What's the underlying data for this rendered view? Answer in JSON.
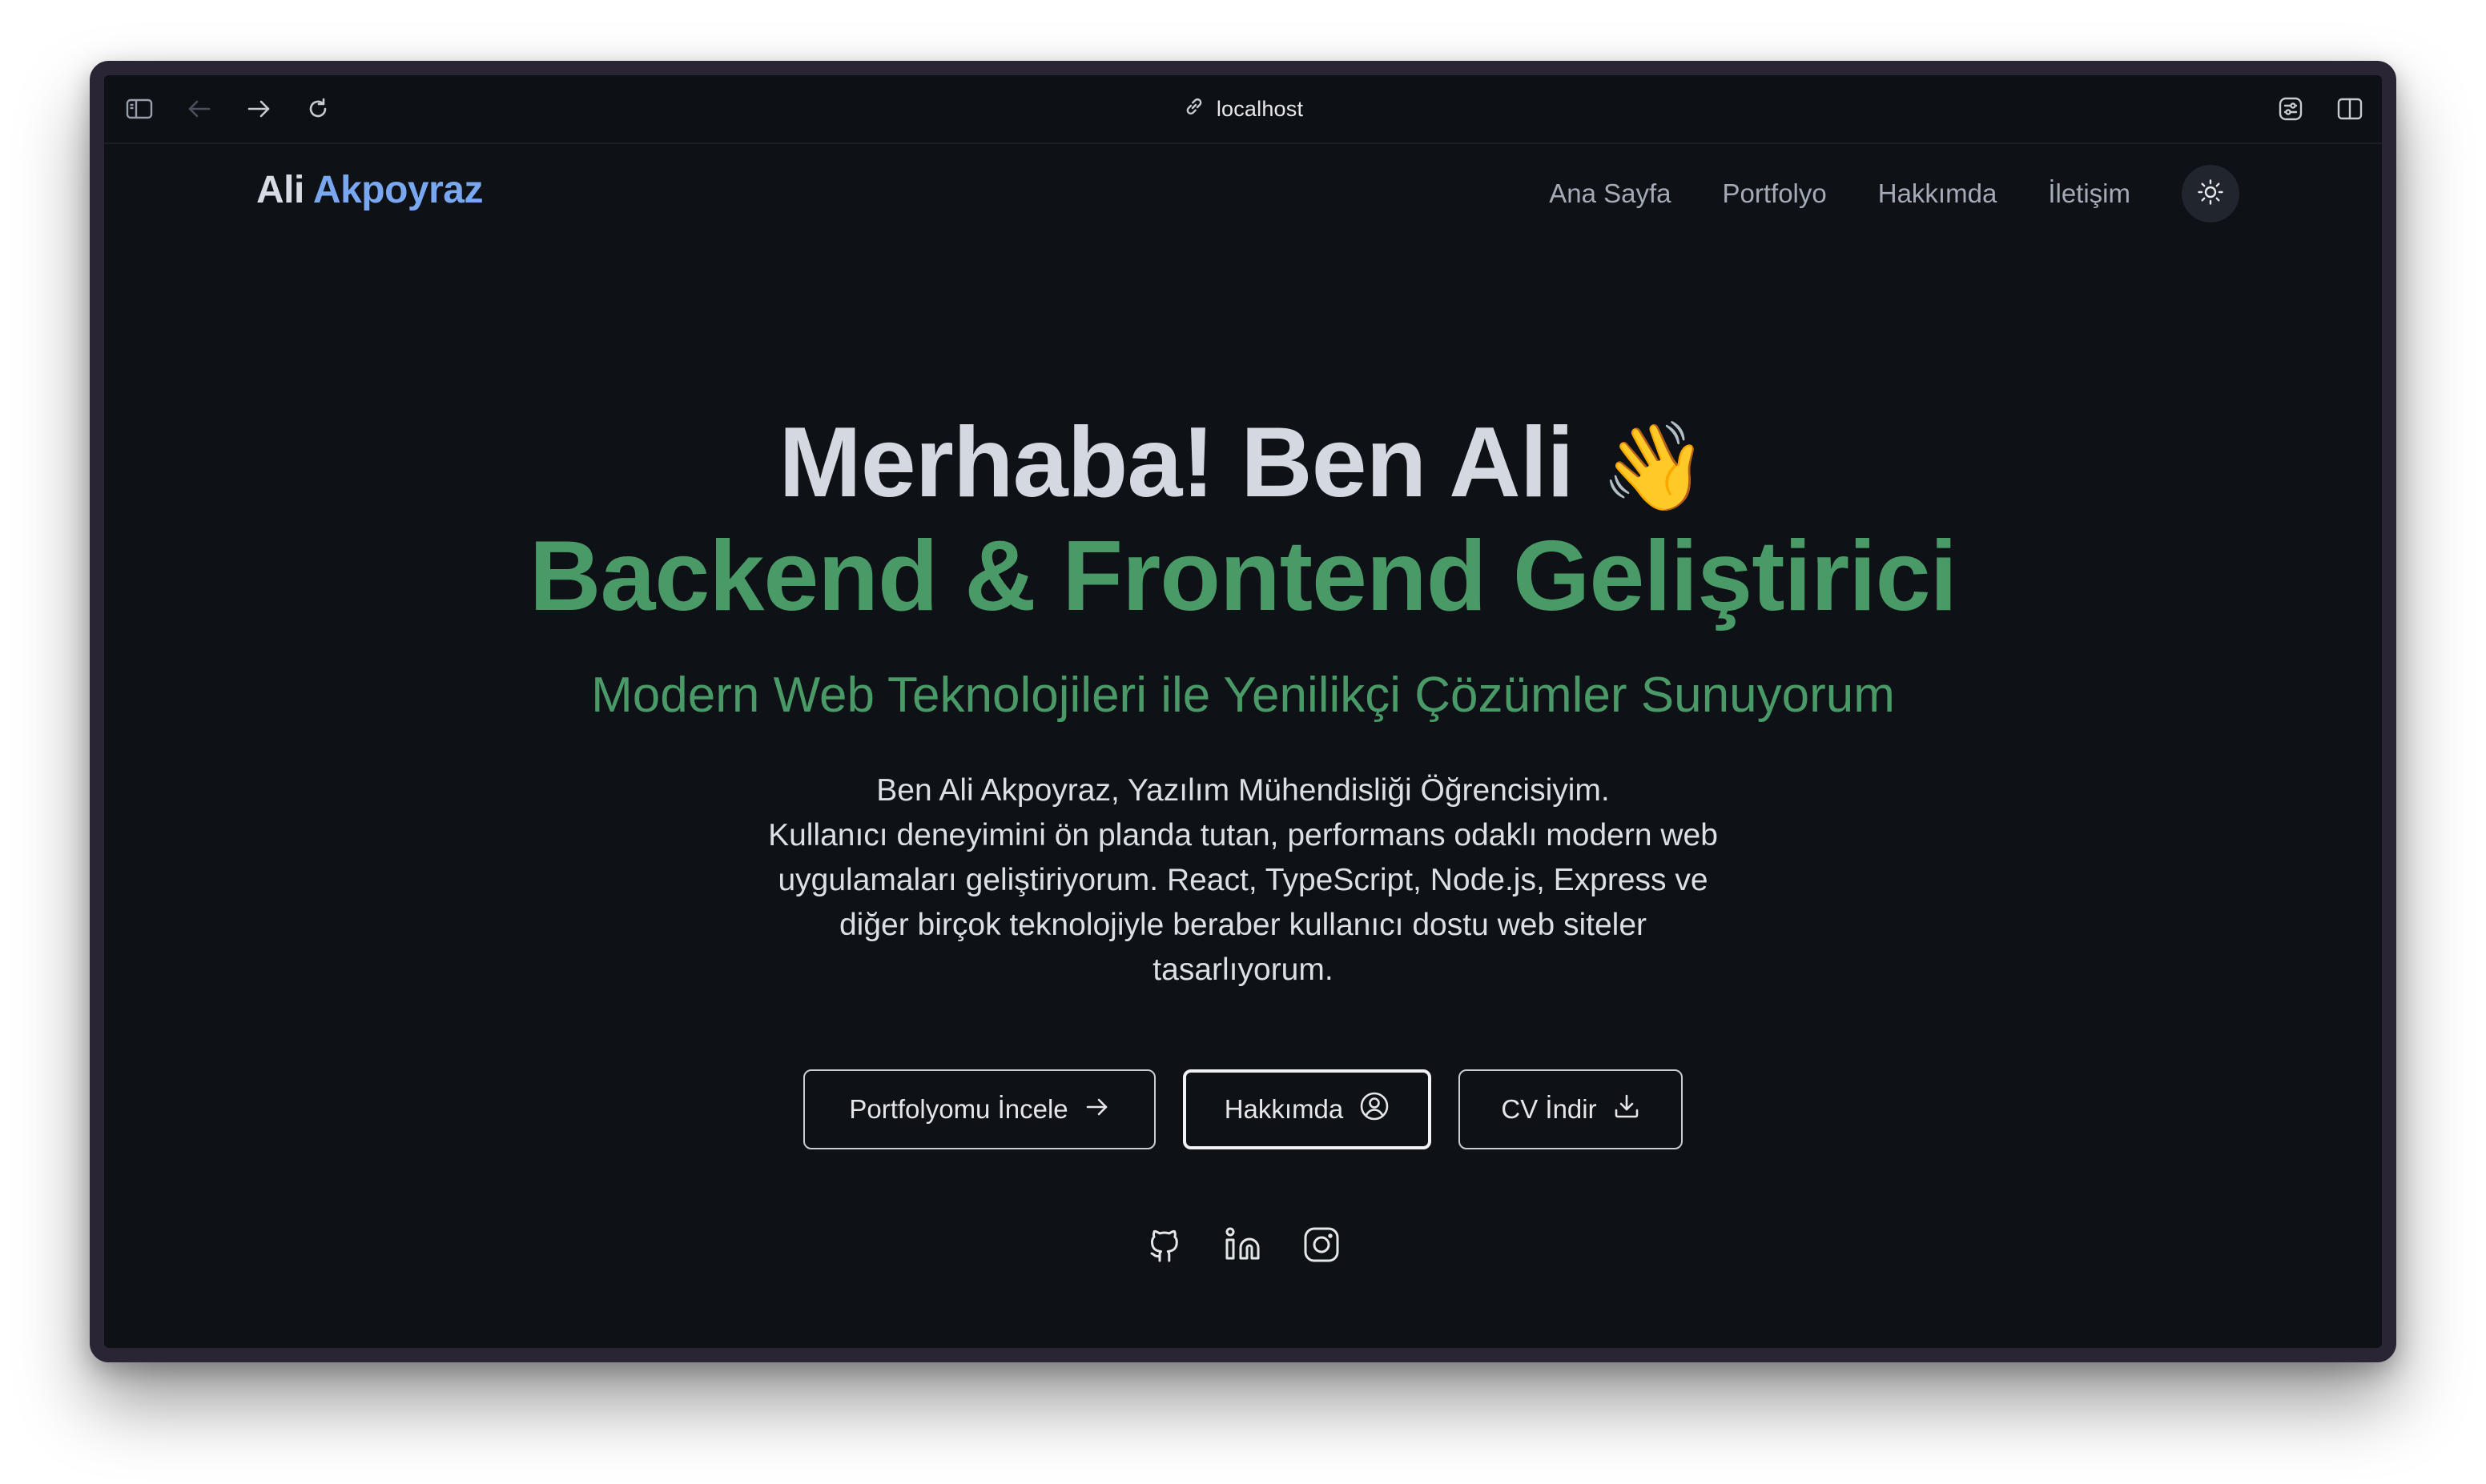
{
  "browser": {
    "url": "localhost",
    "icons": [
      "sidebar-toggle-icon",
      "back-arrow-icon",
      "forward-arrow-icon",
      "reload-icon",
      "link-icon",
      "extensions-icon",
      "split-view-icon"
    ]
  },
  "header": {
    "logo_first": "Ali",
    "logo_second": "Akpoyraz",
    "nav": [
      "Ana Sayfa",
      "Portfolyo",
      "Hakkımda",
      "İletişim"
    ],
    "theme_icon": "sun-icon"
  },
  "hero": {
    "title": "Merhaba! Ben Ali",
    "wave_emoji": "👋",
    "role": "Backend & Frontend Geliştirici",
    "tagline": "Modern Web Teknolojileri ile Yenilikçi Çözümler Sunuyorum",
    "description_lines": [
      "Ben Ali Akpoyraz, Yazılım Mühendisliği Öğrencisiyim.",
      "Kullanıcı deneyimini ön planda tutan, performans odaklı modern web",
      "uygulamaları geliştiriyorum. React, TypeScript, Node.js, Express ve",
      "diğer birçok teknolojiyle beraber kullanıcı dostu web siteler",
      "tasarlıyorum."
    ]
  },
  "buttons": {
    "portfolio": "Portfolyomu İncele",
    "about": "Hakkımda",
    "cv": "CV İndir"
  },
  "social": [
    "github-icon",
    "linkedin-icon",
    "instagram-icon"
  ],
  "colors": {
    "background": "#0e1116",
    "accent_blue": "#7aa8f0",
    "accent_green": "#4a9a68",
    "heading": "#d4d8e0"
  }
}
